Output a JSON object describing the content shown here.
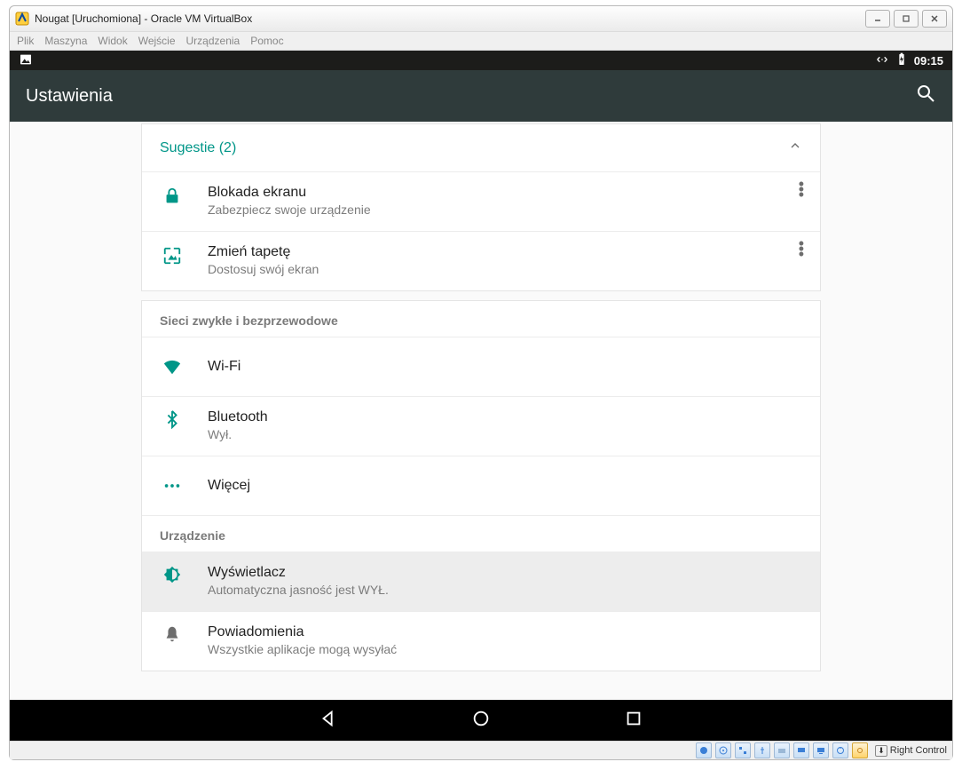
{
  "window": {
    "title": "Nougat [Uruchomiona] - Oracle VM VirtualBox",
    "menu": [
      "Plik",
      "Maszyna",
      "Widok",
      "Wejście",
      "Urządzenia",
      "Pomoc"
    ]
  },
  "statusbar": {
    "time": "09:15"
  },
  "appbar": {
    "title": "Ustawienia"
  },
  "suggestions": {
    "header": "Sugestie (2)",
    "items": [
      {
        "title": "Blokada ekranu",
        "subtitle": "Zabezpiecz swoje urządzenie"
      },
      {
        "title": "Zmień tapetę",
        "subtitle": "Dostosuj swój ekran"
      }
    ]
  },
  "sections": {
    "network": {
      "header": "Sieci zwykłe i bezprzewodowe",
      "wifi": {
        "title": "Wi-Fi"
      },
      "bluetooth": {
        "title": "Bluetooth",
        "subtitle": "Wył."
      },
      "more": {
        "title": "Więcej"
      }
    },
    "device": {
      "header": "Urządzenie",
      "display": {
        "title": "Wyświetlacz",
        "subtitle": "Automatyczna jasność jest WYŁ."
      },
      "notifications": {
        "title": "Powiadomienia",
        "subtitle": "Wszystkie aplikacje mogą wysyłać"
      }
    }
  },
  "vb_status": {
    "host_key": "Right Control"
  }
}
